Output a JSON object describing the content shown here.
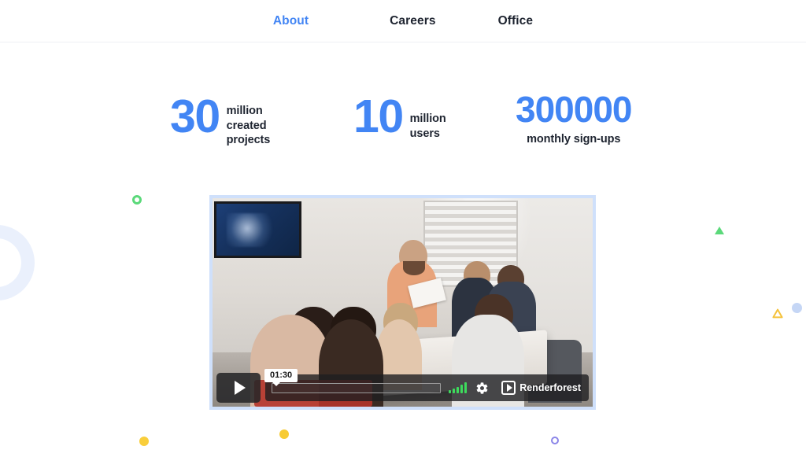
{
  "nav": {
    "items": [
      {
        "label": "About",
        "active": true,
        "name": "nav-item-about"
      },
      {
        "label": "Careers",
        "active": false,
        "name": "nav-item-careers"
      },
      {
        "label": "Office",
        "active": false,
        "name": "nav-item-office"
      }
    ]
  },
  "stats": [
    {
      "number": "30",
      "label": "million\ncreated\nprojects",
      "label_lines": [
        "million",
        "created",
        "projects"
      ]
    },
    {
      "number": "10",
      "label": "million\nusers",
      "label_lines": [
        "million",
        "users"
      ]
    },
    {
      "number": "300000",
      "label": "monthly sign-ups",
      "label_lines": [
        "monthly sign-ups"
      ]
    }
  ],
  "stat_labels": {
    "one": "million created projects",
    "two": "million users",
    "three": "monthly sign-ups"
  },
  "video": {
    "time_tooltip": "01:30",
    "brand": "Renderforest",
    "play_state": "paused",
    "progress_percent": 0,
    "volume_level": 5,
    "controls": {
      "play": "Play",
      "volume": "Volume",
      "settings": "Settings",
      "progress": "Seek bar"
    },
    "scene_description": "Business team meeting around a white table in a conference room"
  },
  "decor": [
    {
      "name": "green-ring",
      "color": "#5bd97a"
    },
    {
      "name": "green-triangle",
      "color": "#5bd97a"
    },
    {
      "name": "yellow-triangle-ring",
      "color": "#f5c23b"
    },
    {
      "name": "light-blue-dot",
      "color": "#c5d6f5"
    },
    {
      "name": "yellow-dot-left",
      "color": "#f9ce3b"
    },
    {
      "name": "yellow-dot-mid",
      "color": "#f7cb33"
    },
    {
      "name": "purple-ring",
      "color": "#8c86e8"
    },
    {
      "name": "blue-swoosh",
      "color": "#eaf0fc"
    }
  ],
  "colors": {
    "accent": "#4285f4",
    "text": "#1e2430",
    "background": "#ffffff",
    "video_border": "#cfe0fb",
    "nav_border": "#eef0f4"
  }
}
